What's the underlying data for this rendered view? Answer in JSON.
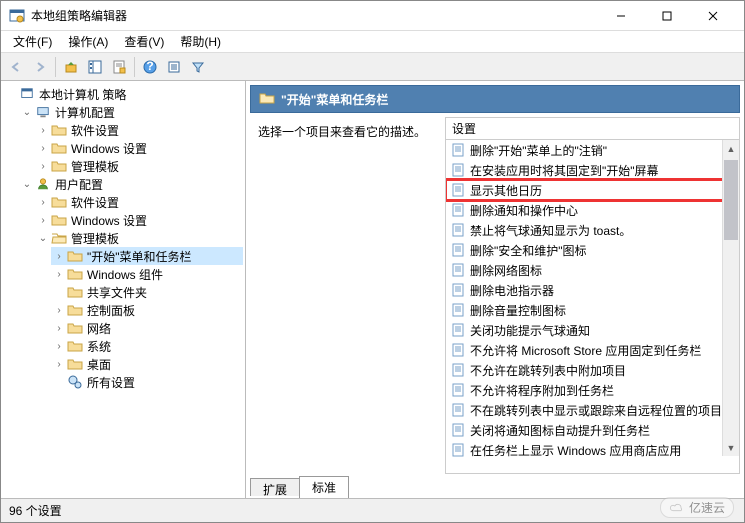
{
  "window": {
    "title": "本地组策略编辑器"
  },
  "menu": {
    "file": "文件(F)",
    "action": "操作(A)",
    "view": "查看(V)",
    "help": "帮助(H)"
  },
  "tree": {
    "root": "本地计算机 策略",
    "computer_cfg": "计算机配置",
    "c_software": "软件设置",
    "c_windows": "Windows 设置",
    "c_admin": "管理模板",
    "user_cfg": "用户配置",
    "u_software": "软件设置",
    "u_windows": "Windows 设置",
    "u_admin": "管理模板",
    "start_taskbar": "\"开始\"菜单和任务栏",
    "win_comp": "Windows 组件",
    "shared": "共享文件夹",
    "ctrl_panel": "控制面板",
    "network": "网络",
    "system": "系统",
    "desktop": "桌面",
    "all_settings": "所有设置"
  },
  "right": {
    "header": "\"开始\"菜单和任务栏",
    "desc": "选择一个项目来查看它的描述。",
    "col_setting": "设置"
  },
  "settings": [
    "删除\"开始\"菜单上的\"注销\"",
    "在安装应用时将其固定到\"开始\"屏幕",
    "显示其他日历",
    "删除通知和操作中心",
    "禁止将气球通知显示为 toast。",
    "删除\"安全和维护\"图标",
    "删除网络图标",
    "删除电池指示器",
    "删除音量控制图标",
    "关闭功能提示气球通知",
    "不允许将 Microsoft Store 应用固定到任务栏",
    "不允许在跳转列表中附加项目",
    "不允许将程序附加到任务栏",
    "不在跳转列表中显示或跟踪来自远程位置的项目",
    "关闭将通知图标自动提升到任务栏",
    "在任务栏上显示 Windows 应用商店应用"
  ],
  "highlighted_index": 2,
  "tabs": {
    "extended": "扩展",
    "standard": "标准"
  },
  "status": {
    "count": "96 个设置"
  },
  "watermark": "亿速云"
}
